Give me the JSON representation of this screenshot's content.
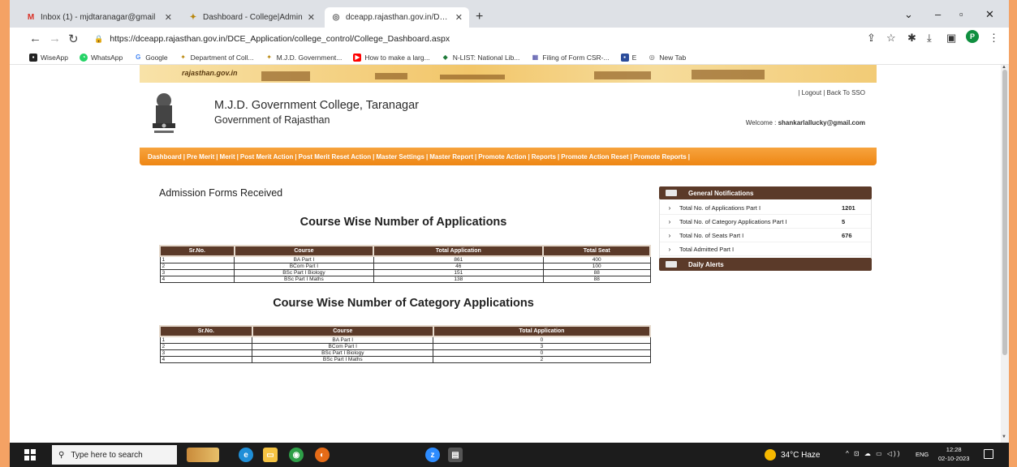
{
  "browser": {
    "tabs": [
      {
        "label": "Inbox (1) - mjdtaranagar@gmail",
        "icon": "gmail-icon"
      },
      {
        "label": "Dashboard - College|Admin",
        "icon": "emblem-icon"
      },
      {
        "label": "dceapp.rajasthan.gov.in/DCE_A",
        "icon": "globe-icon"
      }
    ],
    "url": "https://dceapp.rajasthan.gov.in/DCE_Application/college_control/College_Dashboard.aspx",
    "profile_initial": "P",
    "bookmarks": [
      {
        "label": "WiseApp",
        "icon": "wiseapp-icon",
        "color": "#222222"
      },
      {
        "label": "WhatsApp",
        "icon": "whatsapp-icon",
        "color": "#25d366"
      },
      {
        "label": "Google",
        "icon": "google-icon",
        "color": "#4285f4"
      },
      {
        "label": "Department of Coll...",
        "icon": "emblem-icon",
        "color": "#b8860b"
      },
      {
        "label": "M.J.D. Government...",
        "icon": "emblem-icon",
        "color": "#b8860b"
      },
      {
        "label": "How to make a larg...",
        "icon": "youtube-icon",
        "color": "#ff0000"
      },
      {
        "label": "N-LIST: National Lib...",
        "icon": "nlist-icon",
        "color": "#1f7a3a"
      },
      {
        "label": "Filing of Form CSR-...",
        "icon": "mca-icon",
        "color": "#333399"
      },
      {
        "label": "E",
        "icon": "e-icon",
        "color": "#2b4c9b"
      },
      {
        "label": "New Tab",
        "icon": "globe-icon",
        "color": "#555555"
      }
    ]
  },
  "site": {
    "banner_text": "rajasthan.gov.in",
    "college_name": "M.J.D. Government College, Taranagar",
    "govt": "Government of Rajasthan",
    "logout": "| Logout | Back To SSO",
    "welcome_label": "Welcome :",
    "welcome_user": "shankarlallucky@gmail.com",
    "menu": [
      "Dashboard",
      "Pre Merit",
      "Merit",
      "Post Merit Action",
      "Post Merit Reset Action",
      "Master Settings",
      "Master Report",
      "Promote Action",
      "Reports",
      "Promote Action Reset",
      "Promote Reports"
    ]
  },
  "main": {
    "admission_title": "Admission Forms Received",
    "course_title": "Course Wise Number of Applications",
    "course_table": {
      "headers": [
        "Sr.No.",
        "Course",
        "Total Application",
        "Total Seat"
      ],
      "rows": [
        [
          "1",
          "BA Part I",
          "861",
          "400"
        ],
        [
          "2",
          "BCom Part I",
          "46",
          "100"
        ],
        [
          "3",
          "BSc Part I Biology",
          "151",
          "88"
        ],
        [
          "4",
          "BSc Part I Maths",
          "138",
          "88"
        ]
      ]
    },
    "category_title": "Course Wise Number of Category Applications",
    "category_table": {
      "headers": [
        "Sr.No.",
        "Course",
        "Total Application"
      ],
      "rows": [
        [
          "1",
          "BA Part I",
          "0"
        ],
        [
          "2",
          "BCom Part I",
          "3"
        ],
        [
          "3",
          "BSc Part I Biology",
          "0"
        ],
        [
          "4",
          "BSc Part I Maths",
          "2"
        ]
      ]
    }
  },
  "sidebar": {
    "notifications_title": "General Notifications",
    "notifications": [
      {
        "text": "Total No. of Applications Part I",
        "value": "1201"
      },
      {
        "text": "Total No. of Category Applications Part I",
        "value": "5"
      },
      {
        "text": "Total No. of Seats Part I",
        "value": "676"
      },
      {
        "text": "Total Admitted Part I",
        "value": ""
      }
    ],
    "alerts_title": "Daily Alerts"
  },
  "taskbar": {
    "search_placeholder": "Type here to search",
    "weather": "34°C Haze",
    "lang": "ENG",
    "time": "12:28",
    "date": "02-10-2023"
  },
  "colors": {
    "menu_orange": "#f0901e",
    "table_header": "#5b3a29",
    "outer_border": "#f4a264"
  }
}
